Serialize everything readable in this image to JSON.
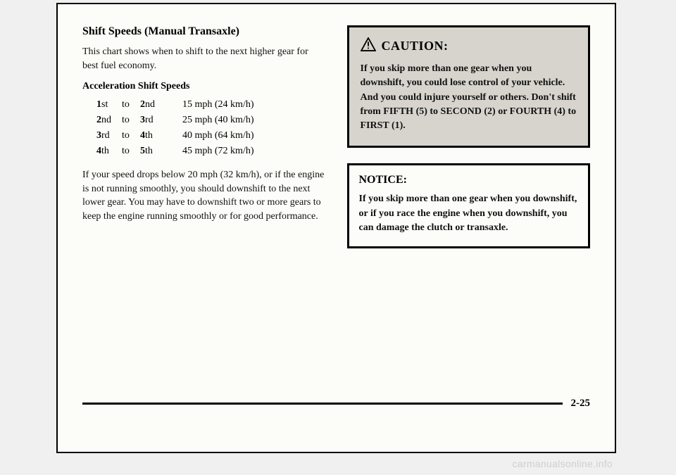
{
  "left": {
    "heading": "Shift Speeds (Manual Transaxle)",
    "intro": "This chart shows when to shift to the next higher gear for best fuel economy.",
    "subheading": "Acceleration Shift Speeds",
    "rows": [
      {
        "from_num": "1",
        "from_sfx": "st",
        "to_word": "to",
        "to_num": "2",
        "to_sfx": "nd",
        "speed": "15 mph (24 km/h)"
      },
      {
        "from_num": "2",
        "from_sfx": "nd",
        "to_word": "to",
        "to_num": "3",
        "to_sfx": "rd",
        "speed": "25 mph (40 km/h)"
      },
      {
        "from_num": "3",
        "from_sfx": "rd",
        "to_word": "to",
        "to_num": "4",
        "to_sfx": "th",
        "speed": "40 mph (64 km/h)"
      },
      {
        "from_num": "4",
        "from_sfx": "th",
        "to_word": "to",
        "to_num": "5",
        "to_sfx": "th",
        "speed": "45 mph (72 km/h)"
      }
    ],
    "body": "If your speed drops below 20 mph (32 km/h), or if the engine is not running smoothly, you should downshift to the next lower gear. You may have to downshift two or more gears to keep the engine running smoothly or for good performance."
  },
  "caution": {
    "title": "CAUTION:",
    "text": "If you skip more than one gear when you downshift, you could lose control of your vehicle. And you could injure yourself or others. Don't shift from FIFTH (5) to SECOND (2) or FOURTH (4) to FIRST (1)."
  },
  "notice": {
    "title": "NOTICE:",
    "text": "If you skip more than one gear when you downshift, or if you race the engine when you downshift, you can damage the clutch or transaxle."
  },
  "page_number": "2-25",
  "watermark": "carmanualsonline.info"
}
